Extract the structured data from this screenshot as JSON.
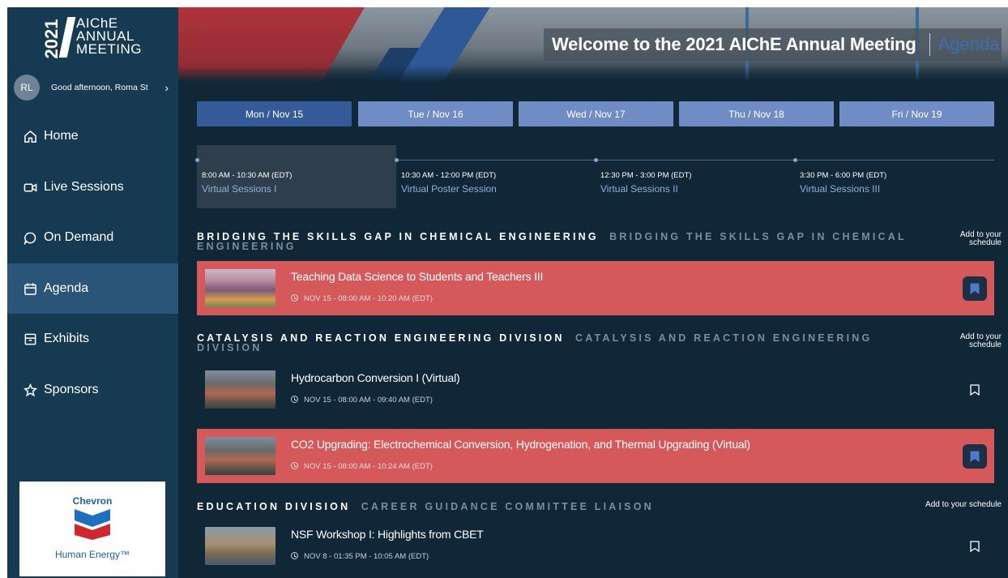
{
  "logo": {
    "year": "2021",
    "name": "AIChE\nANNUAL\nMEETING"
  },
  "user": {
    "initials": "RL",
    "greeting": "Good afternoon, Roma St",
    "chevron": "›"
  },
  "nav": [
    {
      "label": "Home",
      "icon": "home-icon"
    },
    {
      "label": "Live Sessions",
      "icon": "video-icon"
    },
    {
      "label": "On Demand",
      "icon": "chat-bubble-icon"
    },
    {
      "label": "Agenda",
      "icon": "calendar-icon",
      "active": true
    },
    {
      "label": "Exhibits",
      "icon": "exhibit-box-icon"
    },
    {
      "label": "Sponsors",
      "icon": "star-icon"
    }
  ],
  "sponsor": {
    "brand": "Chevron",
    "tagline": "Human Energy™"
  },
  "banner": {
    "title": "Welcome to the 2021 AIChE Annual Meeting",
    "subtitle": "Agenda"
  },
  "days": [
    {
      "label": "Mon / Nov 15",
      "active": true
    },
    {
      "label": "Tue / Nov 16"
    },
    {
      "label": "Wed / Nov 17"
    },
    {
      "label": "Thu / Nov 18"
    },
    {
      "label": "Fri / Nov 19"
    }
  ],
  "slots": [
    {
      "time": "8:00 AM - 10:30 AM (EDT)",
      "title": "Virtual Sessions I",
      "active": true
    },
    {
      "time": "10:30 AM - 12:00 PM (EDT)",
      "title": "Virtual Poster Session"
    },
    {
      "time": "12:30 PM - 3:00 PM (EDT)",
      "title": "Virtual Sessions II"
    },
    {
      "time": "3:30 PM - 6:00 PM (EDT)",
      "title": "Virtual Sessions III"
    }
  ],
  "sections": [
    {
      "title": "BRIDGING THE SKILLS GAP IN CHEMICAL ENGINEERING",
      "subtitle": "BRIDGING THE SKILLS GAP IN CHEMICAL ENGINEERING",
      "add_label": "Add to your\nschedule"
    },
    {
      "title": "CATALYSIS AND REACTION ENGINEERING DIVISION",
      "subtitle": "CATALYSIS AND REACTION ENGINEERING DIVISION",
      "add_label": "Add to your\nschedule"
    },
    {
      "title": "EDUCATION DIVISION",
      "subtitle": "CAREER GUIDANCE COMMITTEE LIAISON",
      "add_label": "Add to your schedule"
    }
  ],
  "sessions": [
    {
      "title": "Teaching Data Science to Students and Teachers III",
      "meta": "NOV 15 - 08:00 AM - 10:20 AM (EDT)",
      "highlighted": true
    },
    {
      "title": "Hydrocarbon Conversion I (Virtual)",
      "meta": "NOV 15 - 08:00 AM - 09:40 AM (EDT)",
      "highlighted": false
    },
    {
      "title": "CO2 Upgrading: Electrochemical Conversion, Hydrogenation, and Thermal Upgrading (Virtual)",
      "meta": "NOV 15 - 08:00 AM - 10:24 AM (EDT)",
      "highlighted": true
    },
    {
      "title": "NSF Workshop I: Highlights from CBET",
      "meta": "NOV 8 - 01:35 PM - 10:05 AM (EDT)",
      "highlighted": false
    }
  ],
  "colors": {
    "accent_red": "#d5595b",
    "nav_active": "#2a5478",
    "tab_active": "#345a98",
    "tab": "#6f8cc4"
  }
}
